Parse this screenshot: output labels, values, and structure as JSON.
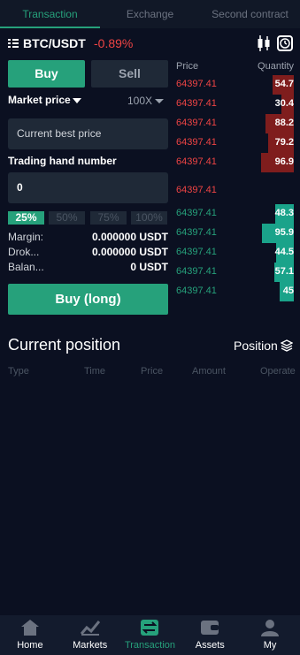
{
  "tabs": [
    {
      "label": "Transaction",
      "active": true
    },
    {
      "label": "Exchange",
      "active": false
    },
    {
      "label": "Second contract",
      "active": false
    }
  ],
  "pair": {
    "name": "BTC/USDT",
    "change": "-0.89%"
  },
  "order": {
    "buy_label": "Buy",
    "sell_label": "Sell",
    "market_label": "Market price",
    "leverage": "100X",
    "price_placeholder": "Current best price",
    "hand_label": "Trading hand number",
    "hand_value": "0",
    "percents": [
      "25%",
      "50%",
      "75%",
      "100%"
    ],
    "margin_label": "Margin:",
    "margin_value": "0.000000 USDT",
    "drok_label": "Drok...",
    "drok_value": "0.000000 USDT",
    "balance_label": "Balan...",
    "balance_value": "0 USDT",
    "submit_label": "Buy (long)"
  },
  "orderbook": {
    "price_header": "Price",
    "qty_header": "Quantity",
    "asks": [
      {
        "price": "64397.41",
        "qty": "54.7"
      },
      {
        "price": "64397.41",
        "qty": "30.4"
      },
      {
        "price": "64397.41",
        "qty": "88.2"
      },
      {
        "price": "64397.41",
        "qty": "79.2"
      },
      {
        "price": "64397.41",
        "qty": "96.9"
      }
    ],
    "mid_price": "64397.41",
    "bids": [
      {
        "price": "64397.41",
        "qty": "48.3"
      },
      {
        "price": "64397.41",
        "qty": "95.9"
      },
      {
        "price": "64397.41",
        "qty": "44.5"
      },
      {
        "price": "64397.41",
        "qty": "57.1"
      },
      {
        "price": "64397.41",
        "qty": "45"
      }
    ]
  },
  "position": {
    "title": "Current position",
    "link": "Position",
    "columns": [
      "Type",
      "Time",
      "Price",
      "Amount",
      "Operate"
    ]
  },
  "nav": [
    {
      "label": "Home",
      "icon": "home-icon"
    },
    {
      "label": "Markets",
      "icon": "chart-icon"
    },
    {
      "label": "Transaction",
      "icon": "swap-icon",
      "active": true
    },
    {
      "label": "Assets",
      "icon": "wallet-icon"
    },
    {
      "label": "My",
      "icon": "user-icon"
    }
  ],
  "colors": {
    "accent": "#26a17b",
    "down": "#ef4444",
    "bg": "#0b1021"
  }
}
